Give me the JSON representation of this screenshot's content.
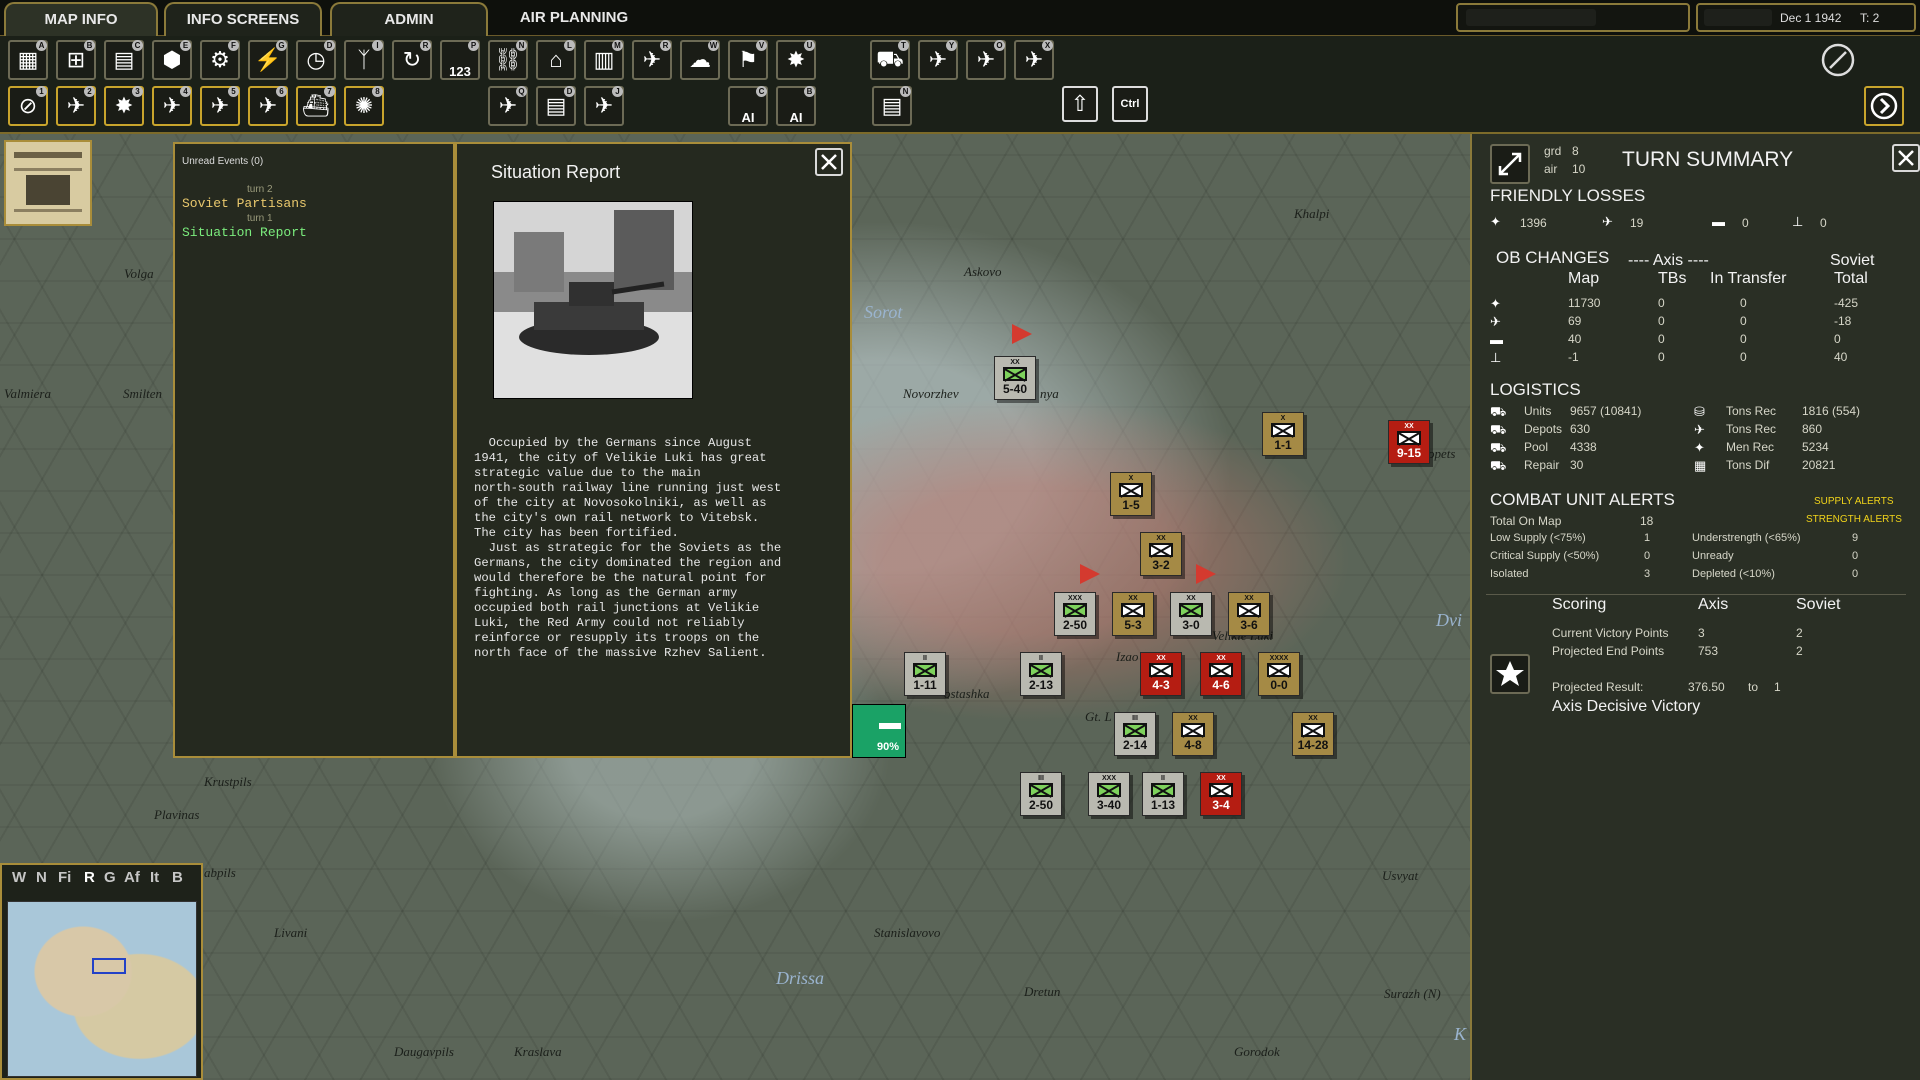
{
  "tabs": [
    {
      "label": "MAP INFO",
      "active": true
    },
    {
      "label": "INFO SCREENS",
      "active": false
    },
    {
      "label": "ADMIN",
      "active": false
    },
    {
      "label": "AIR PLANNING",
      "active": false
    }
  ],
  "status": {
    "date": "Dec 1 1942",
    "turn": "T: 2"
  },
  "toolbar_row1": [
    {
      "icon": "map-overlay-icon",
      "key": "A"
    },
    {
      "icon": "map-plus-icon",
      "key": "B"
    },
    {
      "icon": "map-pages-icon",
      "key": "C"
    },
    {
      "icon": "hex-group-icon",
      "key": "E"
    },
    {
      "icon": "gear-target-icon",
      "key": "F"
    },
    {
      "icon": "artillery-icon",
      "key": "G"
    },
    {
      "icon": "clock-icon",
      "key": "D"
    },
    {
      "icon": "radio-tower-icon",
      "key": "I"
    },
    {
      "icon": "cycle-icon",
      "key": "R"
    },
    {
      "icon": "counter-123-icon",
      "key": "P",
      "text": "123"
    },
    {
      "icon": "network-icon",
      "key": "N"
    },
    {
      "icon": "factory-icon",
      "key": "L"
    },
    {
      "icon": "building-icon",
      "key": "M"
    },
    {
      "icon": "airfield-icon",
      "key": "R"
    },
    {
      "icon": "weather-icon",
      "key": "W"
    },
    {
      "icon": "flag-icon",
      "key": "V"
    },
    {
      "icon": "explosion-icon",
      "key": "U"
    }
  ],
  "toolbar_row1_right": [
    {
      "icon": "supply-truck-icon",
      "key": "T"
    },
    {
      "icon": "air-supply-icon",
      "key": "Y"
    },
    {
      "icon": "air-mission-icon",
      "key": "O"
    },
    {
      "icon": "air-recon-icon",
      "key": "X"
    }
  ],
  "toolbar_row2": [
    {
      "icon": "air-cancel-icon",
      "key": "1"
    },
    {
      "icon": "air-ground-icon",
      "key": "2"
    },
    {
      "icon": "air-bomb-icon",
      "key": "3"
    },
    {
      "icon": "air-city-icon",
      "key": "4"
    },
    {
      "icon": "air-interdict-icon",
      "key": "5"
    },
    {
      "icon": "air-strike-icon",
      "key": "6"
    },
    {
      "icon": "air-naval-icon",
      "key": "7"
    },
    {
      "icon": "air-blast-icon",
      "key": "8"
    }
  ],
  "toolbar_row2_mid": [
    {
      "icon": "air-directive-icon",
      "key": "Q"
    },
    {
      "icon": "air-doc-icon",
      "key": "D"
    },
    {
      "icon": "air-off-icon",
      "key": "J"
    },
    {
      "icon": "ai-on-icon",
      "key": "C",
      "text": "AI"
    },
    {
      "icon": "ai-off-icon",
      "key": "B",
      "text": "AI"
    },
    {
      "icon": "doc-list-icon",
      "key": "N"
    }
  ],
  "toolbar_row2_right": [
    {
      "icon": "shift-key-icon",
      "key": ""
    },
    {
      "icon": "ctrl-key-icon",
      "key": "",
      "text": "Ctrl"
    }
  ],
  "events": {
    "header": "Unread Events (0)",
    "items": [
      {
        "turn": "turn 2",
        "title": "Soviet Partisans"
      },
      {
        "turn": "turn 1",
        "title": "Situation Report"
      }
    ]
  },
  "report": {
    "title": "Situation Report",
    "body": "  Occupied by the Germans since August\n1941, the city of Velikie Luki has great\nstrategic value due to the main\nnorth-south railway line running just west\nof the city at Novosokolniki, as well as\nthe city's own rail network to Vitebsk.\nThe city has been fortified.\n  Just as strategic for the Soviets as the\nGermans, the city dominated the region and\nwould therefore be the natural point for\nfighting. As long as the German army\noccupied both rail junctions at Velikie\nLuki, the Red Army could not reliably\nreinforce or resupply its troops on the\nnorth face of the massive Rzhev Salient."
  },
  "map": {
    "places": [
      "Volga",
      "Valmiera",
      "Smilten",
      "Askovo",
      "Sorot",
      "Novorzhev",
      "nya",
      "Khalpi",
      "Izao",
      "Gt. L",
      "ostashka",
      "opets",
      "Vellkie Luki",
      "Dvi",
      "Krustpils",
      "Plavinas",
      "abpils",
      "Livani",
      "Stanislavovo",
      "Drissa",
      "Dretun",
      "Usvyat",
      "Surazh (N)",
      "Daugavpils",
      "Kraslava",
      "Gorodok",
      "K"
    ],
    "hex_percent": "90%"
  },
  "units": [
    {
      "size": "XX",
      "str": "5-40",
      "color": "g"
    },
    {
      "size": "X",
      "str": "1-1",
      "color": "y"
    },
    {
      "size": "XX",
      "str": "9-15",
      "color": "r"
    },
    {
      "size": "X",
      "str": "1-5",
      "color": "y"
    },
    {
      "size": "XX",
      "str": "3-2",
      "color": "y"
    },
    {
      "size": "XXX",
      "str": "2-50",
      "color": "g",
      "hq": "HQ"
    },
    {
      "size": "XX",
      "str": "5-3",
      "color": "y"
    },
    {
      "size": "XX",
      "str": "3-0",
      "color": "g"
    },
    {
      "size": "XX",
      "str": "3-6",
      "color": "y"
    },
    {
      "size": "II",
      "str": "1-11",
      "color": "g"
    },
    {
      "size": "II",
      "str": "2-13",
      "color": "g"
    },
    {
      "size": "XX",
      "str": "4-3",
      "color": "r"
    },
    {
      "size": "XX",
      "str": "4-6",
      "color": "r"
    },
    {
      "size": "XXXX",
      "str": "0-0",
      "color": "y",
      "hq": "HQ"
    },
    {
      "size": "III",
      "str": "2-14",
      "color": "g"
    },
    {
      "size": "XX",
      "str": "4-8",
      "color": "y"
    },
    {
      "size": "XX",
      "str": "14-28",
      "color": "y"
    },
    {
      "size": "III",
      "str": "2-50",
      "color": "g"
    },
    {
      "size": "XXX",
      "str": "3-40",
      "color": "g",
      "hq": "HQ"
    },
    {
      "size": "II",
      "str": "1-13",
      "color": "g"
    },
    {
      "size": "XX",
      "str": "3-4",
      "color": "r"
    }
  ],
  "summary": {
    "grd_label": "grd",
    "grd": "8",
    "air_label": "air",
    "air": "10",
    "title": "TURN SUMMARY",
    "friendly_losses": {
      "title": "FRIENDLY LOSSES",
      "values": [
        "1396",
        "19",
        "0",
        "0"
      ]
    },
    "ob": {
      "title": "OB CHANGES",
      "axis_header": "---- Axis ----",
      "soviet_header": "Soviet",
      "cols": [
        "Map",
        "TBs",
        "In Transfer",
        "Total"
      ],
      "rows": [
        [
          "11730",
          "0",
          "0",
          "-425"
        ],
        [
          "69",
          "0",
          "0",
          "-18"
        ],
        [
          "40",
          "0",
          "0",
          "0"
        ],
        [
          "-1",
          "0",
          "0",
          "40"
        ]
      ]
    },
    "logistics": {
      "title": "LOGISTICS",
      "left": [
        {
          "label": "Units",
          "value": "9657 (10841)"
        },
        {
          "label": "Depots",
          "value": "630"
        },
        {
          "label": "Pool",
          "value": "4338"
        },
        {
          "label": "Repair",
          "value": "30"
        }
      ],
      "right": [
        {
          "label": "Tons Rec",
          "value": "1816 (554)"
        },
        {
          "label": "Tons Rec",
          "value": "860"
        },
        {
          "label": "Men Rec",
          "value": "5234"
        },
        {
          "label": "Tons Dif",
          "value": "20821"
        }
      ]
    },
    "alerts": {
      "title": "COMBAT UNIT ALERTS",
      "supply_alerts": "SUPPLY ALERTS",
      "strength_alerts": "STRENGTH ALERTS",
      "total_label": "Total On Map",
      "total": "18",
      "left": [
        {
          "label": "Low Supply (<75%)",
          "value": "1"
        },
        {
          "label": "Critical Supply (<50%)",
          "value": "0"
        },
        {
          "label": "Isolated",
          "value": "3"
        }
      ],
      "right": [
        {
          "label": "Understrength (<65%)",
          "value": "9"
        },
        {
          "label": "Unready",
          "value": "0"
        },
        {
          "label": "Depleted (<10%)",
          "value": "0"
        }
      ]
    },
    "scoring": {
      "title": "Scoring",
      "axis": "Axis",
      "soviet": "Soviet",
      "rows": [
        {
          "label": "Current Victory Points",
          "axis": "3",
          "soviet": "2"
        },
        {
          "label": "Projected End Points",
          "axis": "753",
          "soviet": "2"
        }
      ],
      "projected_label": "Projected Result:",
      "projected_value": "376.50",
      "to": "to",
      "projected_value2": "1",
      "result": "Axis Decisive Victory"
    }
  },
  "minimap": {
    "tabs": [
      "W",
      "N",
      "Fi",
      "R",
      "G",
      "Af",
      "It",
      "B"
    ],
    "active": "R"
  }
}
